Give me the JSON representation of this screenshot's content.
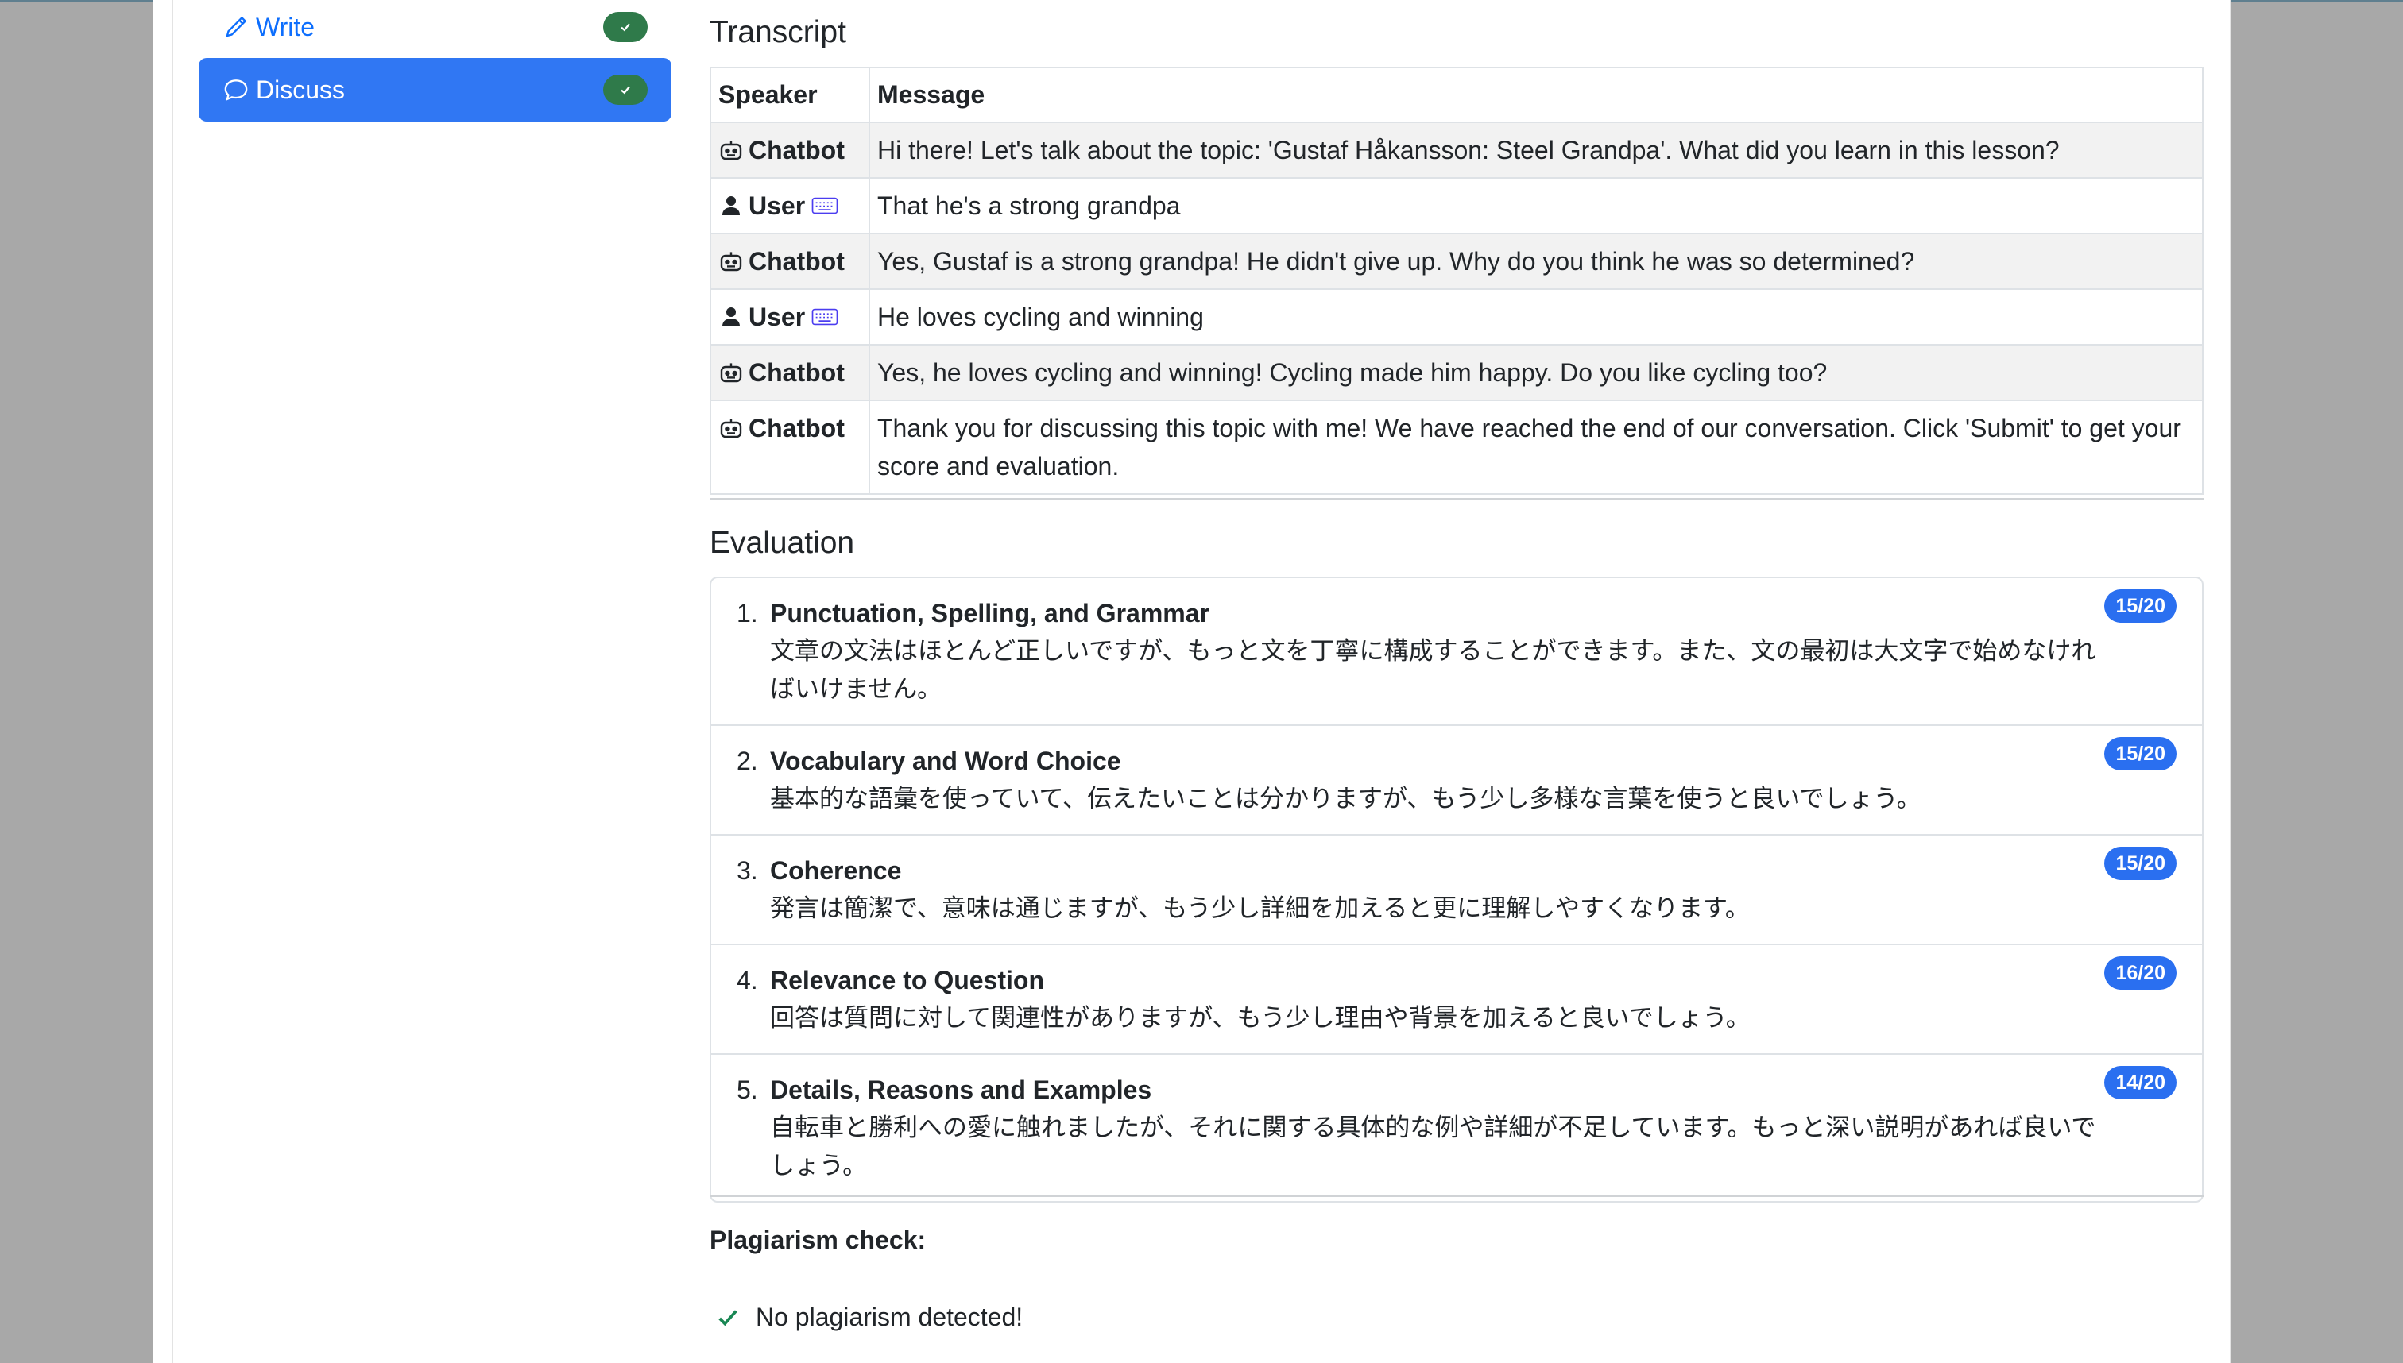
{
  "sidebar": {
    "items": [
      {
        "label": "Write",
        "icon": "pencil-icon",
        "completed": true
      },
      {
        "label": "Discuss",
        "icon": "chat-bubble-icon",
        "completed": true,
        "active": true
      }
    ]
  },
  "transcript": {
    "title": "Transcript",
    "headers": {
      "speaker": "Speaker",
      "message": "Message"
    },
    "rows": [
      {
        "speaker": "Chatbot",
        "message": "Hi there! Let's talk about the topic: 'Gustaf Håkansson: Steel Grandpa'. What did you learn in this lesson?"
      },
      {
        "speaker": "User",
        "message": "That he's a strong grandpa"
      },
      {
        "speaker": "Chatbot",
        "message": "Yes, Gustaf is a strong grandpa! He didn't give up. Why do you think he was so determined?"
      },
      {
        "speaker": "User",
        "message": "He loves cycling and winning"
      },
      {
        "speaker": "Chatbot",
        "message": "Yes, he loves cycling and winning! Cycling made him happy. Do you like cycling too?"
      },
      {
        "speaker": "Chatbot",
        "message": "Thank you for discussing this topic with me! We have reached the end of our conversation. Click 'Submit' to get your score and evaluation."
      }
    ]
  },
  "evaluation": {
    "title": "Evaluation",
    "items": [
      {
        "num": "1.",
        "title": "Punctuation, Spelling, and Grammar",
        "score": "15/20",
        "feedback": "文章の文法はほとんど正しいですが、もっと文を丁寧に構成することができます。また、文の最初は大文字で始めなければいけません。"
      },
      {
        "num": "2.",
        "title": "Vocabulary and Word Choice",
        "score": "15/20",
        "feedback": "基本的な語彙を使っていて、伝えたいことは分かりますが、もう少し多様な言葉を使うと良いでしょう。"
      },
      {
        "num": "3.",
        "title": "Coherence",
        "score": "15/20",
        "feedback": "発言は簡潔で、意味は通じますが、もう少し詳細を加えると更に理解しやすくなります。"
      },
      {
        "num": "4.",
        "title": "Relevance to Question",
        "score": "16/20",
        "feedback": "回答は質問に対して関連性がありますが、もう少し理由や背景を加えると良いでしょう。"
      },
      {
        "num": "5.",
        "title": "Details, Reasons and Examples",
        "score": "14/20",
        "feedback": "自転車と勝利への愛に触れましたが、それに関する具体的な例や詳細が不足しています。もっと深い説明があれば良いでしょう。"
      }
    ]
  },
  "plagiarism": {
    "title": "Plagiarism check:",
    "result": "No plagiarism detected!"
  },
  "colors": {
    "accent": "#3077f3",
    "badge": "#2a6ff0",
    "success": "#2f7a4a",
    "check": "#198754"
  }
}
